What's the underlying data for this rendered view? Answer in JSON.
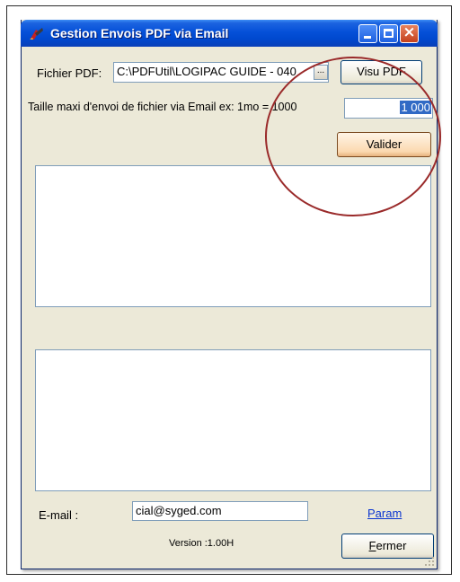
{
  "window": {
    "title": "Gestion Envois PDF via Email"
  },
  "pdf": {
    "label": "Fichier PDF:",
    "path_value": "C:\\PDFUtil\\LOGIPAC GUIDE - 040",
    "browse_label": "...",
    "visu_label": "Visu PDF"
  },
  "size": {
    "label": "Taille maxi d'envoi de fichier via Email ex: 1mo = 1000",
    "value": "1 000",
    "validate_label": "Valider"
  },
  "email": {
    "label": "E-mail :",
    "value": "cial@syged.com",
    "param_label": "Param"
  },
  "footer": {
    "version": "Version :1.00H",
    "close_label": "Fermer"
  },
  "colors": {
    "annotation_circle": "#9a2a2a"
  }
}
